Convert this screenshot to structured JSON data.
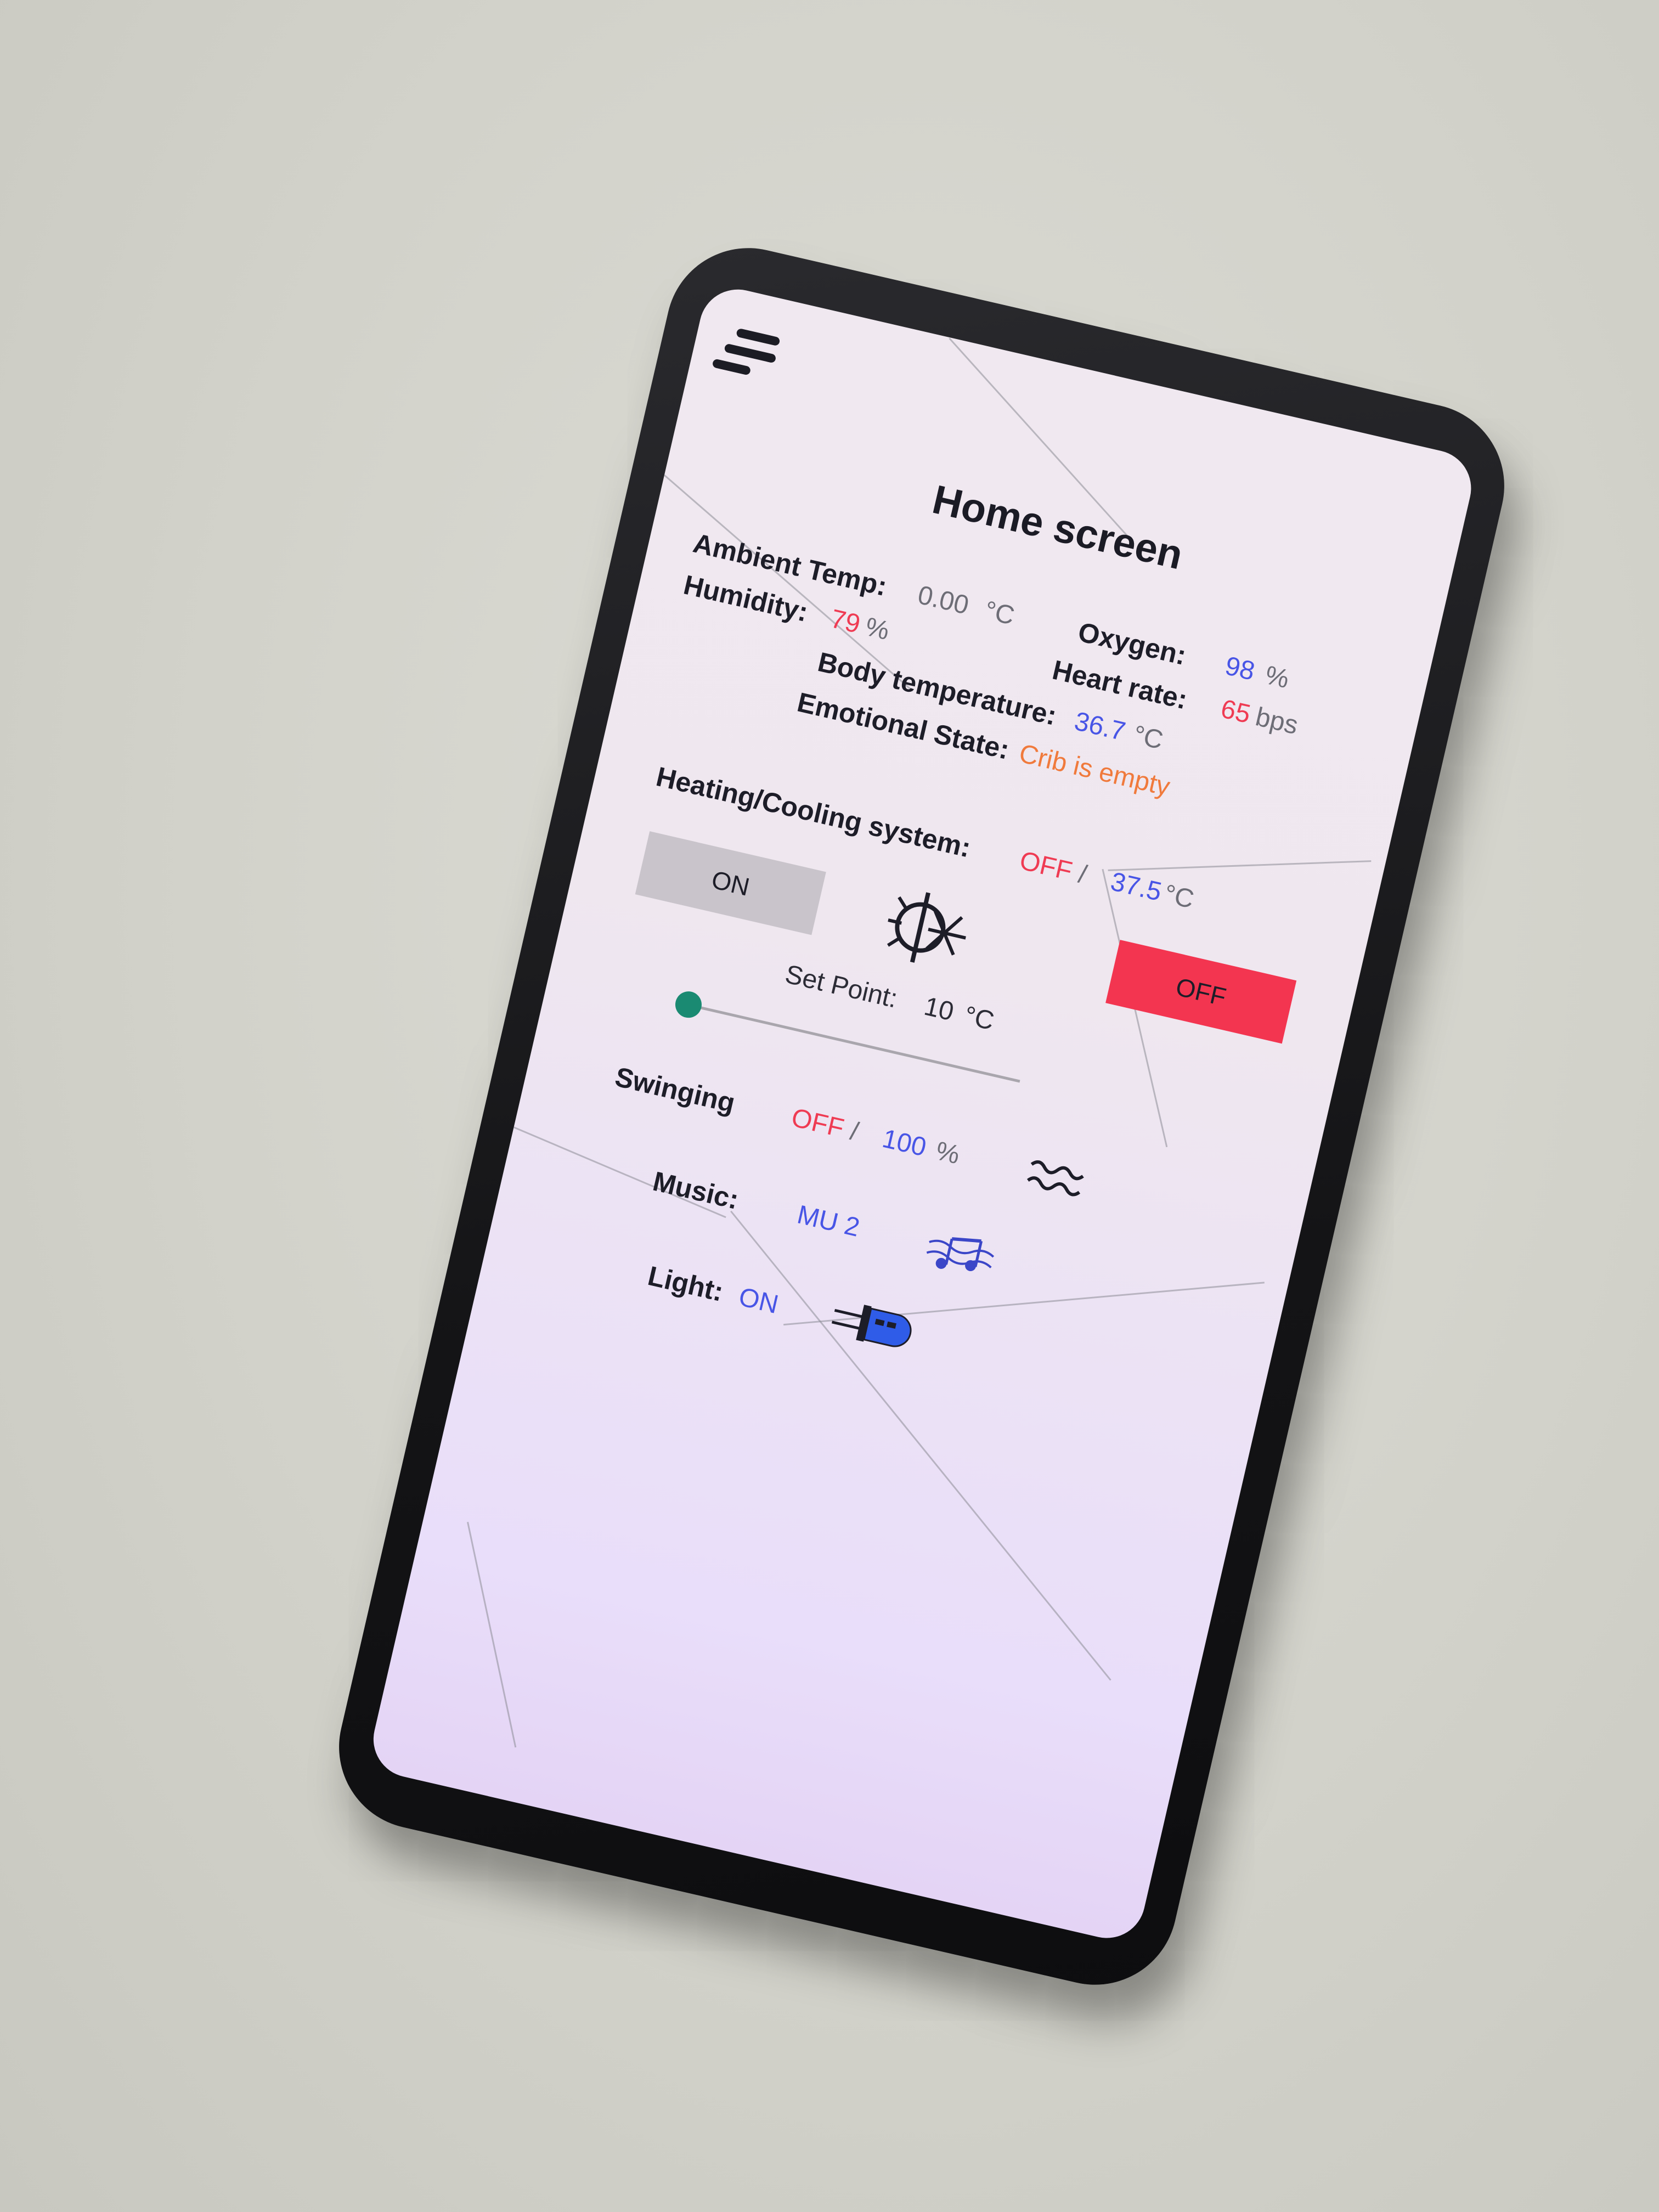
{
  "header": {
    "title": "Home screen"
  },
  "readings": {
    "ambient_temp": {
      "label": "Ambient Temp:",
      "value": "0.00",
      "unit": "°C"
    },
    "oxygen": {
      "label": "Oxygen:",
      "value": "98",
      "unit": "%"
    },
    "humidity": {
      "label": "Humidity:",
      "value": "79",
      "unit": "%"
    },
    "heart_rate": {
      "label": "Heart rate:",
      "value": "65",
      "unit": "bps"
    },
    "body_temperature": {
      "label": "Body temperature:",
      "value": "36.7",
      "unit": "°C"
    },
    "emotional_state": {
      "label": "Emotional State:",
      "value": "Crib is empty"
    }
  },
  "heating_cooling": {
    "label": "Heating/Cooling system:",
    "status": "OFF",
    "separator": "/",
    "target": "37.5",
    "unit": "°C",
    "on_button": "ON",
    "off_button": "OFF",
    "icon": "heat-cool-icon",
    "setpoint_label": "Set Point:",
    "setpoint_value": "10",
    "setpoint_unit": "°C",
    "slider_fraction": 0.0
  },
  "swinging": {
    "label": "Swinging",
    "status": "OFF",
    "separator": "/",
    "level": "100",
    "unit": "%",
    "icon": "wave-icon"
  },
  "music": {
    "label": "Music:",
    "value": "MU 2",
    "icon": "music-notes-icon"
  },
  "light": {
    "label": "Light:",
    "value": "ON",
    "icon": "led-bulb-icon"
  },
  "colors": {
    "red": "#ef3b53",
    "blue": "#4855e6",
    "orange": "#f07a3c",
    "off_button_bg": "#f33550",
    "on_button_bg": "#c9c4cb",
    "slider_thumb": "#1a8a72"
  }
}
